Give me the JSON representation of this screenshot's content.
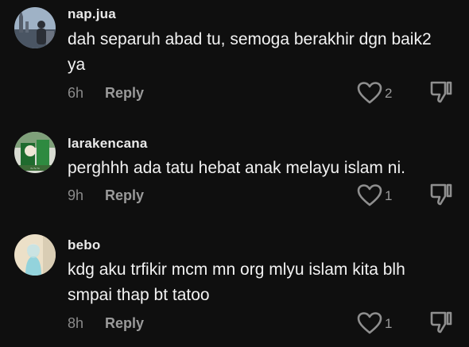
{
  "comments": [
    {
      "username": "nap.jua",
      "text": "dah separuh abad tu, semoga berakhir dgn baik2 ya",
      "time": "6h",
      "reply_label": "Reply",
      "likes": "2",
      "avatar_icon": "avatar-photo-city",
      "avatar_colors": [
        "#6c7f97",
        "#3b4350"
      ]
    },
    {
      "username": "larakencana",
      "text": "perghhh ada tatu hebat anak melayu islam ni.",
      "time": "9h",
      "reply_label": "Reply",
      "likes": "1",
      "avatar_icon": "avatar-photo-green",
      "avatar_colors": [
        "#2b7a3c",
        "#d8e0d0"
      ]
    },
    {
      "username": "bebo",
      "text": "kdg aku trfikir mcm mn org mlyu islam kita blh smpai thap bt tatoo",
      "time": "8h",
      "reply_label": "Reply",
      "likes": "1",
      "avatar_icon": "avatar-photo-person",
      "avatar_colors": [
        "#e9dcc4",
        "#8fd0d8"
      ]
    }
  ],
  "icons": {
    "like": "heart-outline-icon",
    "dislike": "thumbs-down-outline-icon"
  },
  "colors": {
    "background": "#0f0f0f",
    "text": "#f2f2f2",
    "meta": "#8a8a8a"
  }
}
